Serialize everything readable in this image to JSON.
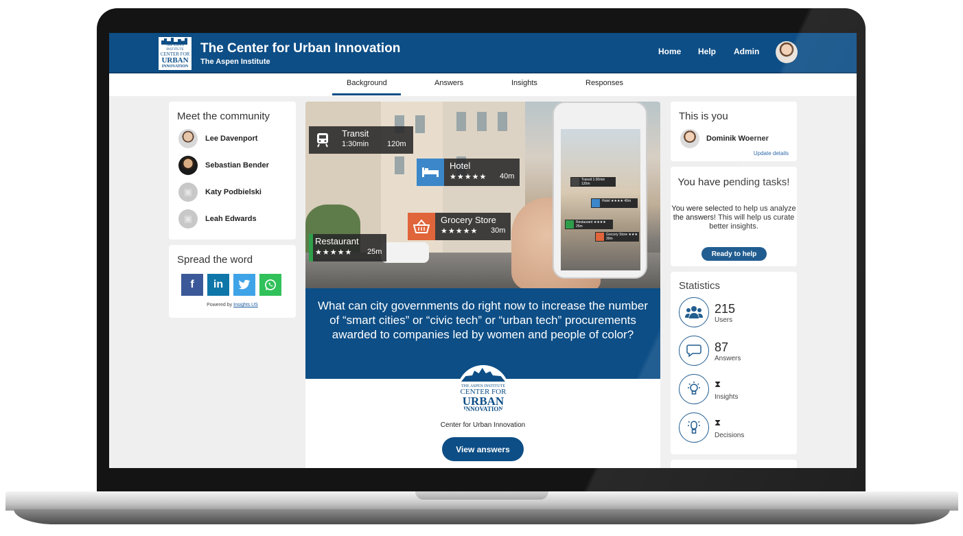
{
  "header": {
    "title": "The Center for Urban Innovation",
    "subtitle": "The Aspen Institute",
    "logo_text": {
      "line1": "THE ASPEN INSTITUTE",
      "line2": "CENTER FOR",
      "line3": "URBAN",
      "line4": "INNOVATION"
    },
    "nav": [
      "Home",
      "Help",
      "Admin"
    ],
    "brand_color": "#0d4e86"
  },
  "tabs": {
    "items": [
      "Background",
      "Answers",
      "Insights",
      "Responses"
    ],
    "active": "Background"
  },
  "community": {
    "title": "Meet the community",
    "people": [
      "Lee Davenport",
      "Sebastian Bender",
      "Katy Podbielski",
      "Leah Edwards"
    ]
  },
  "share": {
    "title": "Spread the word",
    "powered_prefix": "Powered by",
    "powered_link": "Insights.US",
    "networks": [
      "facebook-icon",
      "linkedin-icon",
      "twitter-icon",
      "whatsapp-icon"
    ],
    "colors": {
      "facebook": "#3b5998",
      "linkedin": "#0e76a8",
      "twitter": "#3fa3e8",
      "whatsapp": "#31c15a"
    }
  },
  "hero": {
    "tags": {
      "transit": {
        "name": "Transit",
        "time": "1:30min",
        "distance": "120m"
      },
      "hotel": {
        "name": "Hotel",
        "stars": "★★★★★",
        "distance": "40m"
      },
      "grocery": {
        "name": "Grocery Store",
        "stars": "★★★★★",
        "distance": "30m"
      },
      "restaurant": {
        "name": "Restaurant",
        "stars": "★★★★★",
        "distance": "25m"
      }
    },
    "mini_tags": {
      "transit": "Transit 1:30min 120m",
      "hotel": "Hotel ★★★★ 40m",
      "restaurant": "Restaurant ★★★★ 25m",
      "grocery": "Grocery Store ★★★ 30m"
    }
  },
  "question": "What can city governments do right now to increase the number of “smart cities” or “civic tech” or “urban tech” procurements awarded to companies led by women and people of color?",
  "org": {
    "name": "Center for Urban Innovation",
    "logo": {
      "line1": "THE ASPEN INSTITUTE",
      "line2": "CENTER FOR",
      "line3": "URBAN",
      "line4": "INNOVATION"
    },
    "button": "View answers"
  },
  "you": {
    "title": "This is you",
    "name": "Dominik Woerner",
    "update_link": "Update details"
  },
  "pending": {
    "title": "You have pending tasks!",
    "body": "You were selected to help us analyze the answers! This will help us curate better insights.",
    "button": "Ready to help"
  },
  "statistics": {
    "title": "Statistics",
    "items": [
      {
        "value": "215",
        "label": "Users",
        "icon": "users-icon"
      },
      {
        "value": "87",
        "label": "Answers",
        "icon": "speech-bubble-icon"
      },
      {
        "value": "⧗",
        "label": "Insights",
        "icon": "lightbulb-icon"
      },
      {
        "value": "⧗",
        "label": "Decisions",
        "icon": "decision-bulb-icon"
      }
    ]
  }
}
